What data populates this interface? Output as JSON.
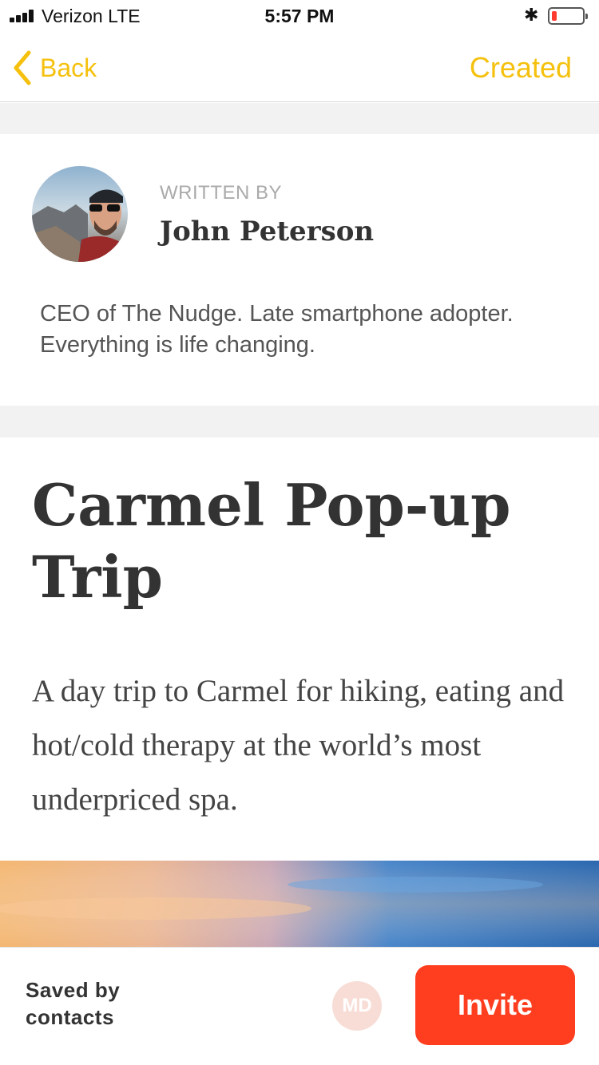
{
  "status_bar": {
    "carrier": "Verizon  LTE",
    "time": "5:57 PM",
    "bluetooth_icon": "bluetooth-icon",
    "battery_level": 0.15
  },
  "nav": {
    "back_label": "Back",
    "action_label": "Created",
    "accent_color": "#f5c10e"
  },
  "author": {
    "written_by_label": "WRITTEN BY",
    "name": "John Peterson",
    "bio": "CEO of The Nudge. Late smartphone adopter. Everything is life changing."
  },
  "article": {
    "title": "Carmel Pop-up Trip",
    "description": "A day trip to Carmel for hiking, eating and hot/cold therapy at the world’s most underpriced spa."
  },
  "footer": {
    "saved_by_line1": "Saved by",
    "saved_by_line2": "contacts",
    "contact_initials": "MD",
    "invite_label": "Invite",
    "invite_color": "#ff3d1f"
  }
}
